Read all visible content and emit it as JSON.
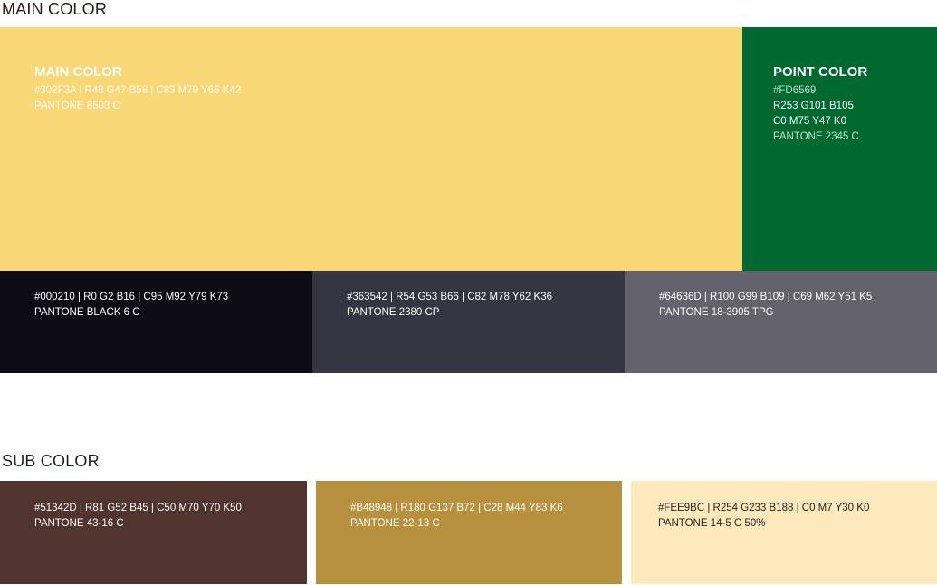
{
  "main_section": {
    "title": "MAIN COLOR"
  },
  "sub_section": {
    "title": "SUB COLOR"
  },
  "main_color": {
    "heading": "MAIN COLOR",
    "line1": "#302F3A | R48 G47 B58 | C83 M79 Y65 K42",
    "line2": "PANTONE 8603 C",
    "swatch_color": "#F9D776"
  },
  "point_color": {
    "heading": "POINT COLOR",
    "hex": "#FD6569",
    "rgb": "R253 G101 B105",
    "cmyk": "C0 M75 Y47 K0",
    "pantone": "PANTONE 2345 C",
    "swatch_color": "#006930"
  },
  "main_row": [
    {
      "line1": "#000210 | R0 G2 B16 | C95 M92 Y79 K73",
      "line2": "PANTONE BLACK 6 C",
      "swatch_color": "#0D0C16"
    },
    {
      "line1": "#363542 | R54 G53 B66 | C82 M78 Y62 K36",
      "line2": "PANTONE 2380 CP",
      "swatch_color": "#363542"
    },
    {
      "line1": "#64636D | R100 G99 B109 | C69 M62 Y51 K5",
      "line2": "PANTONE 18-3905 TPG",
      "swatch_color": "#64636D"
    }
  ],
  "sub_row": [
    {
      "line1": "#51342D | R81 G52 B45 | C50 M70 Y70 K50",
      "line2": "PANTONE 43-16 C",
      "swatch_color": "#51342D"
    },
    {
      "line1": "#B48948 | R180 G137 B72 | C28 M44 Y83 K6",
      "line2": "PANTONE 22-13 C",
      "swatch_color": "#B8913E"
    },
    {
      "line1": "#FEE9BC | R254 G233 B188 | C0 M7 Y30 K0",
      "line2": "PANTONE 14-5 C 50%",
      "swatch_color": "#FEE9BC"
    }
  ]
}
